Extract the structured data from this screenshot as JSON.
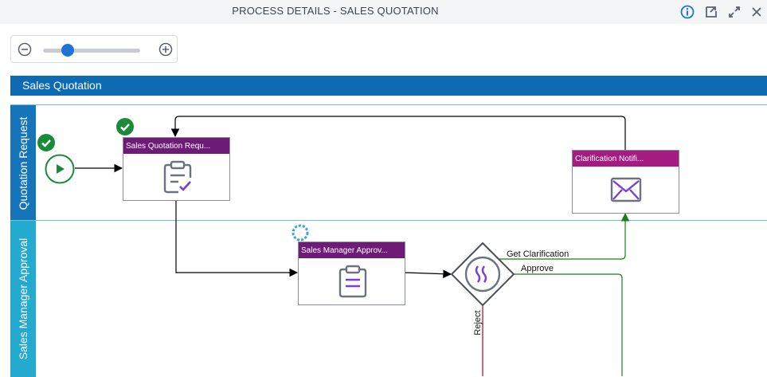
{
  "header": {
    "title": "PROCESS DETAILS - SALES QUOTATION",
    "icons": [
      "info-icon",
      "export-icon",
      "expand-icon",
      "close-icon"
    ]
  },
  "zoom": {
    "level": 0.25,
    "icons": [
      "zoom-out-icon",
      "zoom-in-icon"
    ]
  },
  "pool": {
    "title": "Sales Quotation",
    "color": "#0c6bb3"
  },
  "lanes": [
    {
      "label": "Quotation Request",
      "color": "#1675b8"
    },
    {
      "label": "Sales Manager Approval",
      "color": "#24a9cf"
    }
  ],
  "tasks": [
    {
      "label": "Sales Quotation Requ...",
      "color": "#6e1a77",
      "icon": "clipboard-check-icon",
      "status": "completed"
    },
    {
      "label": "Clarification Notifi...",
      "color": "#a61b82",
      "icon": "mail-icon"
    },
    {
      "label": "Sales Manager Approv...",
      "color": "#6e1a77",
      "icon": "clipboard-list-icon",
      "status": "in-progress"
    }
  ],
  "gateway": {
    "icon": "gateway-icon"
  },
  "start_event": {
    "icon": "play-icon",
    "status": "completed"
  },
  "flows": {
    "get_clarification": "Get Clarification",
    "approve": "Approve",
    "reject": "Reject"
  },
  "colors": {
    "completed": "#1b8a3a",
    "approve_line": "#1b7e1b",
    "reject_line": "#b3001b",
    "in_progress": "#38a4e0",
    "lane_border": "#6fc3d6"
  }
}
